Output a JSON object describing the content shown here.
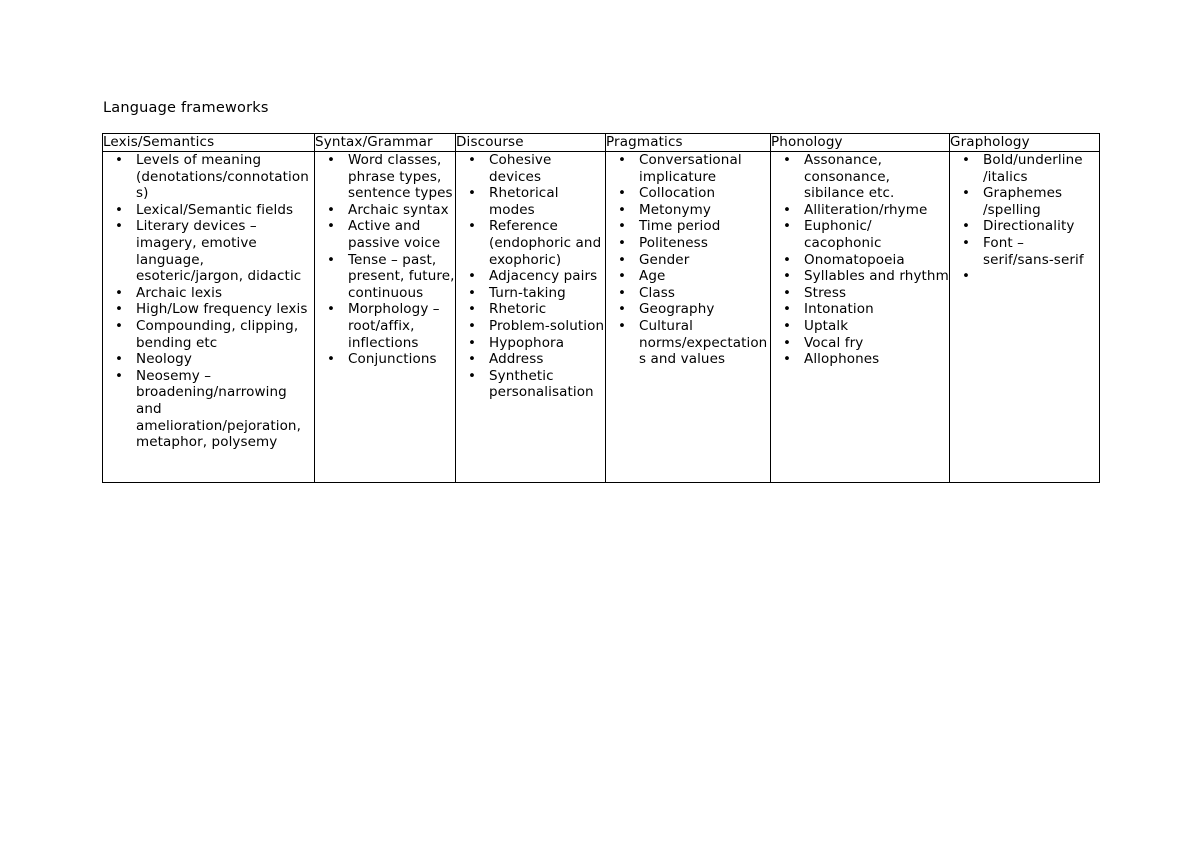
{
  "document": {
    "title": "Language frameworks"
  },
  "table": {
    "columns": [
      {
        "header": "Lexis/Semantics",
        "items": [
          "Levels of meaning (denotations/connotations)",
          "Lexical/Semantic fields",
          "Literary devices – imagery, emotive language, esoteric/jargon, didactic",
          "Archaic lexis",
          "High/Low frequency lexis",
          "Compounding, clipping, bending etc",
          "Neology",
          "Neosemy – broadening/narrowing and amelioration/pejoration, metaphor, polysemy"
        ]
      },
      {
        "header": "Syntax/Grammar",
        "items": [
          "Word classes, phrase types, sentence types",
          "Archaic syntax",
          "Active and passive voice",
          "Tense – past, present, future, continuous",
          "Morphology – root/affix, inflections",
          "Conjunctions"
        ]
      },
      {
        "header": "Discourse",
        "items": [
          "Cohesive devices",
          "Rhetorical modes",
          "Reference (endophoric and exophoric)",
          "Adjacency pairs",
          "Turn-taking",
          "Rhetoric",
          "Problem-solution",
          "Hypophora",
          "Address",
          "Synthetic personalisation"
        ]
      },
      {
        "header": "Pragmatics",
        "items": [
          "Conversational implicature",
          "Collocation",
          "Metonymy",
          "Time period",
          "Politeness",
          "Gender",
          "Age",
          "Class",
          "Geography",
          "Cultural norms/expectations and values"
        ]
      },
      {
        "header": "Phonology",
        "items": [
          "Assonance, consonance, sibilance etc.",
          "Alliteration/rhyme",
          "Euphonic/ cacophonic",
          "Onomatopoeia",
          "Syllables and rhythm",
          "Stress",
          "Intonation",
          "Uptalk",
          "Vocal fry",
          "Allophones"
        ]
      },
      {
        "header": "Graphology",
        "items": [
          "Bold/underline /italics",
          "Graphemes /spelling",
          "Directionality",
          "Font – serif/sans-serif",
          ""
        ]
      }
    ],
    "bullet_glyph": "•"
  }
}
